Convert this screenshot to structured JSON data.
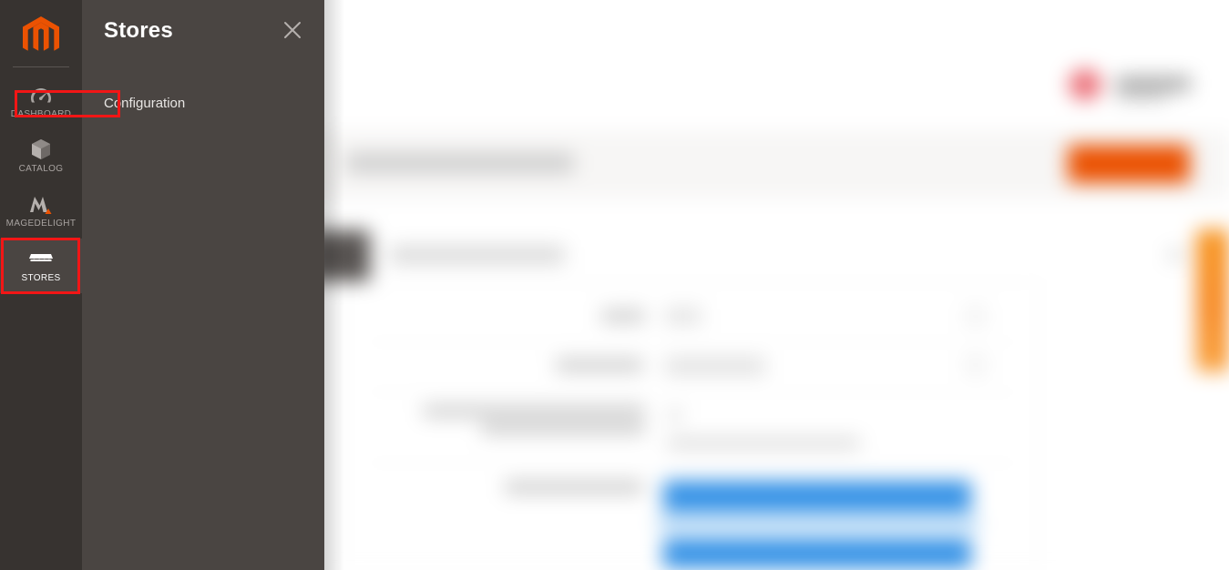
{
  "app": {
    "brand": "magento-logo",
    "accent_orange": "#eb5202",
    "sidebar_bg": "#373330",
    "flyout_bg": "#4a4542",
    "highlight_color": "#f21616",
    "selected_blue": "#3391e6"
  },
  "sidebar": {
    "logo_name": "magento-logo",
    "items": [
      {
        "label": "DASHBOARD",
        "icon": "dashboard-gauge-icon",
        "active": false
      },
      {
        "label": "CATALOG",
        "icon": "catalog-box-icon",
        "active": false
      },
      {
        "label": "MAGEDELIGHT",
        "icon": "magedelight-icon",
        "active": false
      },
      {
        "label": "STORES",
        "icon": "stores-shop-icon",
        "active": true
      }
    ]
  },
  "flyout": {
    "title": "Stores",
    "close_icon": "close-icon",
    "links": [
      {
        "label": "Configuration",
        "highlighted": true
      }
    ]
  },
  "annotations": {
    "nav_highlight_target": "STORES",
    "link_highlight_target": "Configuration"
  },
  "background": {
    "blurred": true,
    "description": "Magento admin configuration page behind the open Stores menu",
    "side_tab_color": "#f7941e",
    "primary_button_color": "#eb5202",
    "notification_badge_color": "#e8555f"
  }
}
